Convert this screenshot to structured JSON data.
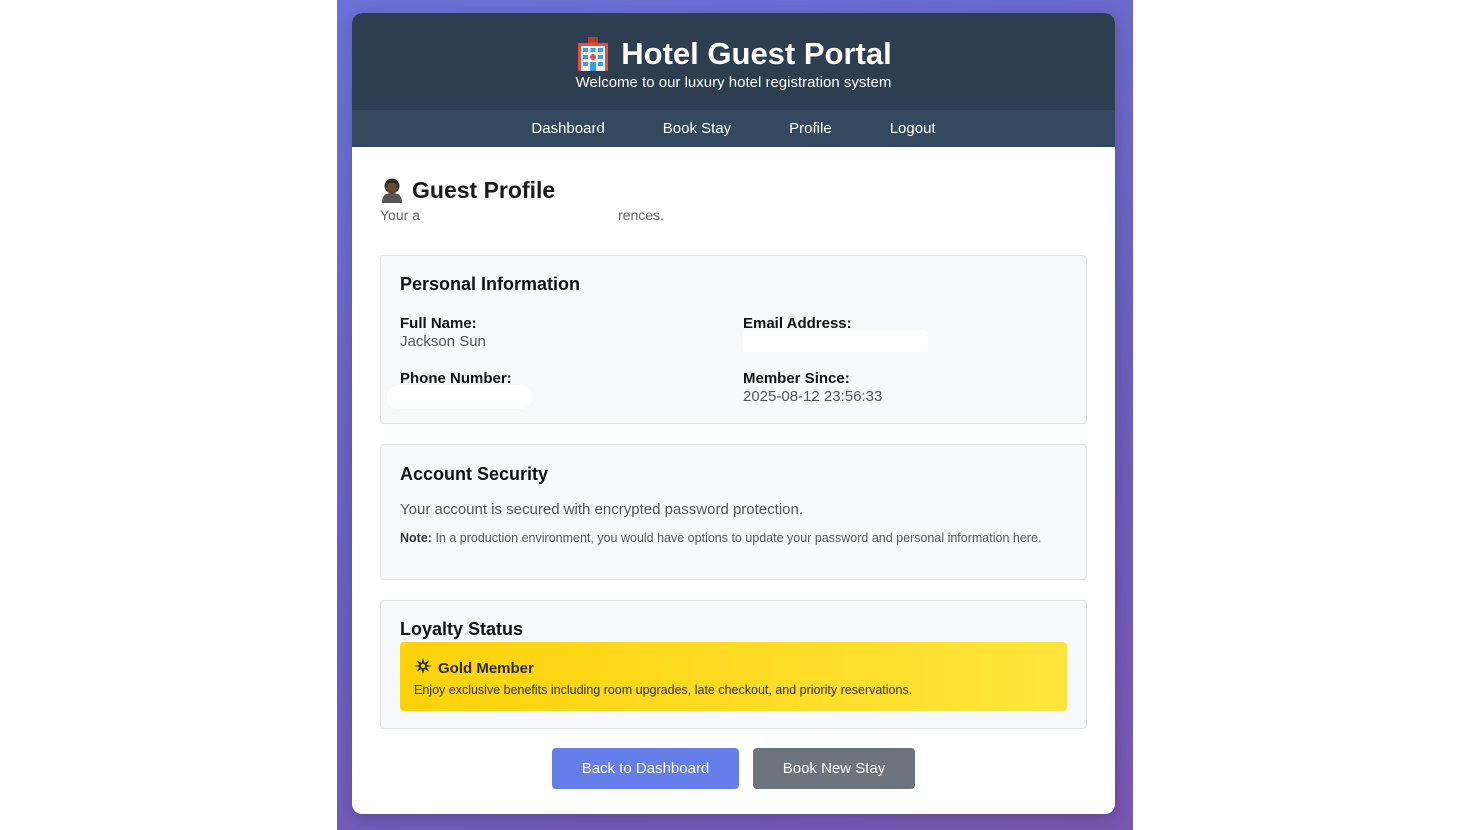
{
  "header": {
    "title": "Hotel Guest Portal",
    "subtitle": "Welcome to our luxury hotel registration system",
    "logo_icon": "hotel-icon"
  },
  "nav": {
    "items": [
      {
        "label": "Dashboard"
      },
      {
        "label": "Book Stay"
      },
      {
        "label": "Profile"
      },
      {
        "label": "Logout"
      }
    ]
  },
  "page": {
    "title": "Guest Profile",
    "title_icon": "person-icon",
    "subtitle_start": "Your a",
    "subtitle_end": "rences."
  },
  "personal": {
    "heading": "Personal Information",
    "full_name_label": "Full Name:",
    "full_name": "Jackson Sun",
    "email_label": "Email Address:",
    "email": "",
    "phone_label": "Phone Number:",
    "phone": "",
    "member_since_label": "Member Since:",
    "member_since": "2025-08-12 23:56:33"
  },
  "security": {
    "heading": "Account Security",
    "text": "Your account is secured with encrypted password protection.",
    "note_label": "Note:",
    "note_text": "In a production environment, you would have options to update your password and personal information here."
  },
  "loyalty": {
    "heading": "Loyalty Status",
    "tier": "Gold Member",
    "tier_icon": "sparkle-icon",
    "benefits": "Enjoy exclusive benefits including room upgrades, late checkout, and priority reservations."
  },
  "buttons": {
    "back": "Back to Dashboard",
    "book": "Book New Stay"
  },
  "colors": {
    "header_bg": "#2c3e50",
    "nav_bg": "#34495e",
    "primary": "#667eea",
    "secondary": "#6c757d",
    "gold": "#fdd20a"
  }
}
